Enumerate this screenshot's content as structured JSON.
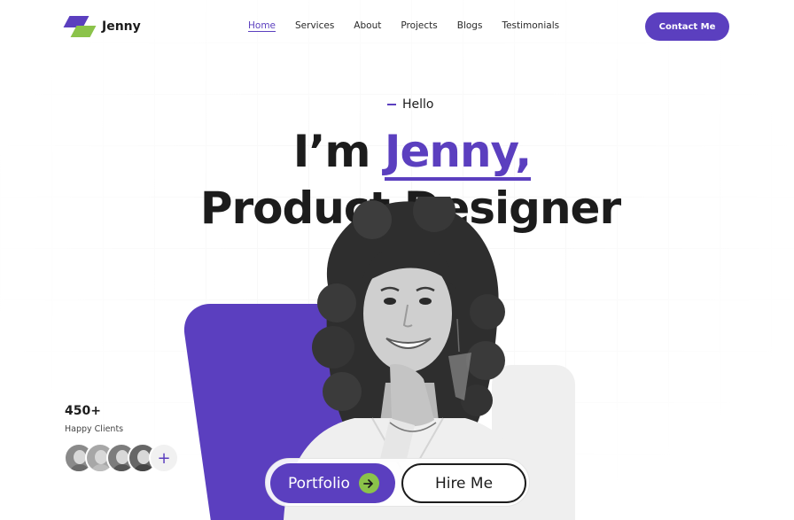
{
  "brand": {
    "name": "Jenny",
    "accent": "#5b3fbf",
    "secondary": "#8bc34a"
  },
  "nav": {
    "items": [
      {
        "label": "Home",
        "active": true
      },
      {
        "label": "Services"
      },
      {
        "label": "About"
      },
      {
        "label": "Projects"
      },
      {
        "label": "Blogs"
      },
      {
        "label": "Testimonials"
      }
    ],
    "contact_label": "Contact Me"
  },
  "hero": {
    "greeting": "Hello",
    "title_prefix": "I’m ",
    "title_name": "Jenny,",
    "title_line2": "Product Designer"
  },
  "clients": {
    "count": "450+",
    "label": "Happy Clients",
    "add_icon": "plus-icon"
  },
  "actions": {
    "portfolio_label": "Portfolio",
    "portfolio_icon": "arrow-right-icon",
    "hire_label": "Hire Me"
  }
}
